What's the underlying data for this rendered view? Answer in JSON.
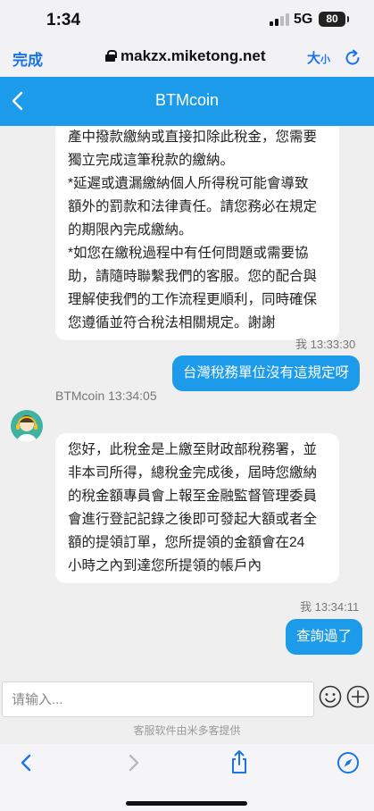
{
  "status": {
    "time": "1:34",
    "network": "5G",
    "battery": "80"
  },
  "browser": {
    "done_label": "完成",
    "url": "makzx.miketong.net",
    "text_size_big": "大",
    "text_size_small": "小",
    "icons": [
      "lock-icon",
      "reload-icon"
    ]
  },
  "header": {
    "title": "BTMcoin",
    "back_icon": "chevron-left-icon"
  },
  "colors": {
    "accent": "#1c9bea",
    "background": "#efefef",
    "bubble_left": "#ffffff"
  },
  "messages": [
    {
      "side": "left",
      "text": "產中撥款繳納或直接扣除此稅金，您需要\n獨立完成這筆稅款的繳納。\n*延遲或遺漏繳納個人所得稅可能會導致\n額外的罰款和法律責任。請您務必在規定\n的期限內完成繳納。\n*如您在繳稅過程中有任何問題或需要協\n助，請隨時聯繫我們的客服。您的配合與\n理解使我們的工作流程更順利，同時確保\n您遵循並符合稅法相關規定。謝謝"
    },
    {
      "side": "right",
      "meta": "我 13:33:30",
      "text": "台灣稅務單位沒有這規定呀"
    },
    {
      "side": "left",
      "meta": "BTMcoin 13:34:05",
      "text": "您好，此稅金是上繳至財政部稅務署，並\n非本司所得，總稅金完成後，屆時您繳納\n的稅金額專員會上報至金融監督管理委員\n會進行登記記錄之後即可發起大額或者全\n額的提領訂單，您所提領的金額會在24\n小時之內到達您所提領的帳戶內"
    },
    {
      "side": "right",
      "meta": "我 13:34:11",
      "text": "查詢過了"
    }
  ],
  "input": {
    "placeholder": "请输入...",
    "value": "",
    "powered_by": "客服软件由米多客提供",
    "icons": [
      "emoji-icon",
      "plus-icon"
    ]
  },
  "toolbar": {
    "icons": [
      "back-arrow-icon",
      "forward-arrow-icon",
      "share-icon",
      "compass-icon"
    ]
  }
}
